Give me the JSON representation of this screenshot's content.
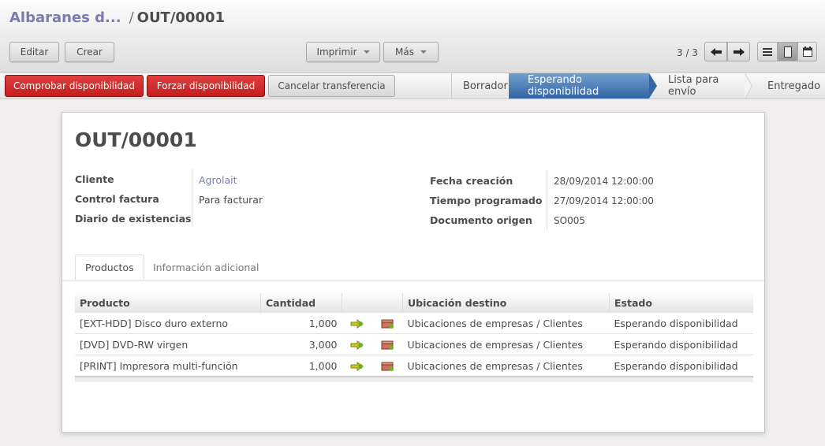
{
  "breadcrumb": {
    "parent": "Albaranes d...",
    "separator": "/",
    "current": "OUT/00001"
  },
  "toolbar": {
    "edit": "Editar",
    "create": "Crear",
    "print": "Imprimir",
    "more": "Más"
  },
  "pager": {
    "text": "3 / 3"
  },
  "actions": {
    "check_availability": "Comprobar disponibilidad",
    "force_availability": "Forzar disponibilidad",
    "cancel_transfer": "Cancelar transferencia"
  },
  "statusbar": {
    "steps": [
      "Borrador",
      "Esperando disponibilidad",
      "Lista para envío",
      "Entregado"
    ],
    "active": "Esperando disponibilidad",
    "active_color": "#3a6eb0"
  },
  "record": {
    "title": "OUT/00001",
    "left_fields": [
      {
        "label": "Cliente",
        "value": "Agrolait"
      },
      {
        "label": "Control factura",
        "value": "Para facturar"
      },
      {
        "label": "Diario de existencias",
        "value": ""
      }
    ],
    "right_fields": [
      {
        "label": "Fecha creación",
        "value": "28/09/2014 12:00:00"
      },
      {
        "label": "Tiempo programado",
        "value": "27/09/2014 12:00:00"
      },
      {
        "label": "Documento origen",
        "value": "SO005"
      }
    ]
  },
  "tabs": [
    "Productos",
    "Información adicional"
  ],
  "table": {
    "headers": [
      "Producto",
      "Cantidad",
      "",
      "Ubicación destino",
      "Estado"
    ],
    "rows": [
      {
        "product": "[EXT-HDD] Disco duro externo",
        "qty": "1,000",
        "dest": "Ubicaciones de empresas / Clientes",
        "state": "Esperando disponibilidad"
      },
      {
        "product": "[DVD] DVD-RW virgen",
        "qty": "3,000",
        "dest": "Ubicaciones de empresas / Clientes",
        "state": "Esperando disponibilidad"
      },
      {
        "product": "[PRINT] Impresora multi-función",
        "qty": "1,000",
        "dest": "Ubicaciones de empresas / Clientes",
        "state": "Esperando disponibilidad"
      }
    ]
  },
  "colors": {
    "danger": "#c41e1e",
    "link": "#7c7bad"
  }
}
